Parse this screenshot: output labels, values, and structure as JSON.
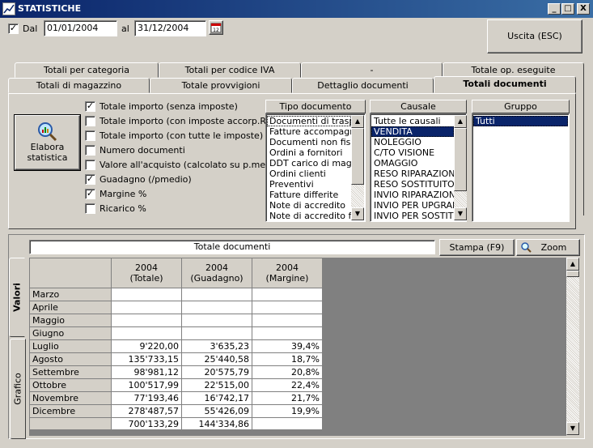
{
  "window": {
    "title": "STATISTICHE",
    "controls": [
      "_",
      "□",
      "X"
    ]
  },
  "filter": {
    "from_checked": true,
    "from_label": "Dal",
    "from_date": "01/01/2004",
    "to_label": "al",
    "to_date": "31/12/2004",
    "calendar_icon": "calendar-icon",
    "exit_label": "Uscita (ESC)"
  },
  "tabs_back": [
    "Totali per categoria",
    "Totali per codice IVA",
    "-",
    "Totale op. eseguite"
  ],
  "tabs_front": [
    "Totali di magazzino",
    "Totale provvigioni",
    "Dettaglio documenti",
    "Totali documenti"
  ],
  "active_tab": "Totali documenti",
  "elabora": {
    "label_line1": "Elabora",
    "label_line2": "statistica",
    "icon": "magnifier-chart-icon"
  },
  "options": [
    {
      "label": "Totale importo (senza imposte)",
      "checked": true
    },
    {
      "label": "Totale importo (con imposte accorp.RSM)",
      "checked": false
    },
    {
      "label": "Totale importo (con tutte le imposte)",
      "checked": false
    },
    {
      "label": "Numero documenti",
      "checked": false
    },
    {
      "label": "Valore all'acquisto (calcolato su p.medio)",
      "checked": false
    },
    {
      "label": "Guadagno (/pmedio)",
      "checked": true
    },
    {
      "label": "Margine %",
      "checked": true
    },
    {
      "label": "Ricarico %",
      "checked": false
    }
  ],
  "tipo_documento": {
    "header": "Tipo documento",
    "items": [
      "Documenti di trasporto",
      "Fatture accompagnatorie",
      "Documenti non fiscali",
      "Ordini a fornitori",
      "DDT carico di magazzino",
      "Ordini clienti",
      "Preventivi",
      "Fatture differite",
      "Note di accredito",
      "Note di accredito fornitori"
    ],
    "selected": 0
  },
  "causale": {
    "header": "Causale",
    "items": [
      "Tutte le causali",
      "VENDITA",
      "NOLEGGIO",
      "C/TO VISIONE",
      "OMAGGIO",
      "RESO RIPARAZIONE",
      "RESO SOSTITUITO",
      "INVIO  RIPARAZIONE",
      "INVIO PER UPGRADE",
      "INVIO PER SOSTITUZIONE"
    ],
    "selected": 1
  },
  "gruppo": {
    "header": "Gruppo",
    "items": [
      "Tutti"
    ],
    "selected": 0
  },
  "results": {
    "title": "Totale documenti",
    "print_label": "Stampa (F9)",
    "zoom_label": "Zoom",
    "zoom_icon": "zoom-icon",
    "side_tabs": [
      "Valori",
      "Grafico"
    ],
    "columns": [
      {
        "line1": "2004",
        "line2": "(Totale)"
      },
      {
        "line1": "2004",
        "line2": "(Guadagno)"
      },
      {
        "line1": "2004",
        "line2": "(Margine)"
      }
    ],
    "rows": [
      {
        "month": "Marzo",
        "totale": "",
        "guadagno": "",
        "margine": ""
      },
      {
        "month": "Aprile",
        "totale": "",
        "guadagno": "",
        "margine": ""
      },
      {
        "month": "Maggio",
        "totale": "",
        "guadagno": "",
        "margine": ""
      },
      {
        "month": "Giugno",
        "totale": "",
        "guadagno": "",
        "margine": ""
      },
      {
        "month": "Luglio",
        "totale": "9'220,00",
        "guadagno": "3'635,23",
        "margine": "39,4%"
      },
      {
        "month": "Agosto",
        "totale": "135'733,15",
        "guadagno": "25'440,58",
        "margine": "18,7%"
      },
      {
        "month": "Settembre",
        "totale": "98'981,12",
        "guadagno": "20'575,79",
        "margine": "20,8%"
      },
      {
        "month": "Ottobre",
        "totale": "100'517,99",
        "guadagno": "22'515,00",
        "margine": "22,4%"
      },
      {
        "month": "Novembre",
        "totale": "77'193,46",
        "guadagno": "16'742,17",
        "margine": "21,7%"
      },
      {
        "month": "Dicembre",
        "totale": "278'487,57",
        "guadagno": "55'426,09",
        "margine": "19,9%"
      }
    ],
    "total_row": {
      "totale": "700'133,29",
      "guadagno": "144'334,86",
      "margine": ""
    }
  }
}
